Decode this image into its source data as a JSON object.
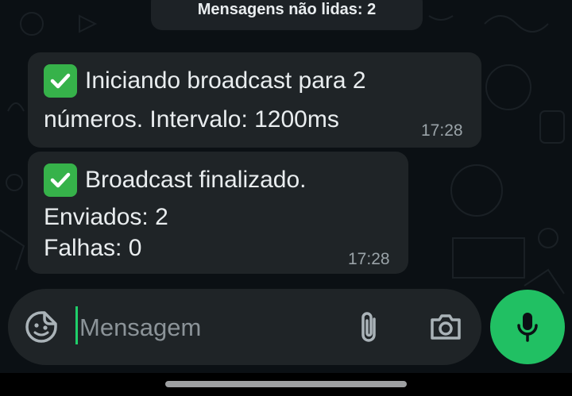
{
  "banner": {
    "unread_text": "Mensagens não lidas: 2"
  },
  "messages": [
    {
      "line1": "Iniciando broadcast para 2",
      "line2": "números. Intervalo: 1200ms",
      "time": "17:28",
      "icon": "check-mark-button-emoji"
    },
    {
      "line1": "Broadcast finalizado.",
      "line2": "Enviados: 2",
      "line3": "Falhas: 0",
      "time": "17:28",
      "icon": "check-mark-button-emoji"
    }
  ],
  "composer": {
    "placeholder": "Mensagem",
    "sticker_icon": "sticker-icon",
    "attach_icon": "paperclip-icon",
    "camera_icon": "camera-icon",
    "mic_icon": "microphone-icon"
  },
  "colors": {
    "background": "#0b1014",
    "bubble": "#1f2427",
    "accent": "#21c063",
    "check": "#36b24a"
  }
}
